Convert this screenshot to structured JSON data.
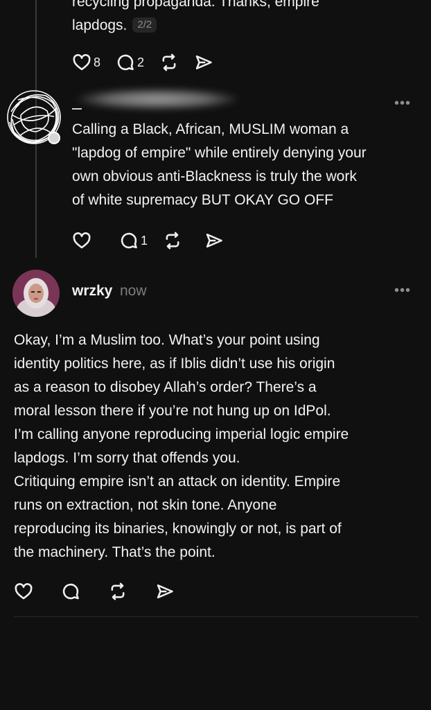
{
  "top_post": {
    "partial_line": "recycling propaganda. Thanks, empire",
    "last_line": "lapdogs.",
    "pager": "2/2",
    "likes": "8",
    "replies": "2"
  },
  "reply_post": {
    "lines": [
      "Calling a Black, African, MUSLIM woman a",
      "\"lapdog of empire\" while entirely denying your",
      "own obvious anti-Blackness is truly the work",
      "of white supremacy BUT OKAY GO OFF"
    ],
    "replies": "1",
    "more": "•••"
  },
  "main_post": {
    "username": "wrzky",
    "time": "now",
    "more": "•••",
    "lines": [
      "Okay, I’m a Muslim too. What’s your point using",
      "identity politics here, as if Iblis didn’t use his origin",
      "as a reason to disobey Allah’s order? There’s a",
      "moral lesson there if you’re not hung up on IdPol.",
      "I’m calling anyone reproducing imperial logic empire",
      "lapdogs. I’m sorry that offends you.",
      "Critiquing empire isn’t an attack on identity. Empire",
      "runs on extraction, not skin tone. Anyone",
      "reproducing its binaries, knowingly or not, is part of",
      "the machinery. That’s the point."
    ]
  },
  "icons": {
    "like": "heart-icon",
    "reply": "comment-icon",
    "repost": "repost-icon",
    "share": "send-icon"
  }
}
